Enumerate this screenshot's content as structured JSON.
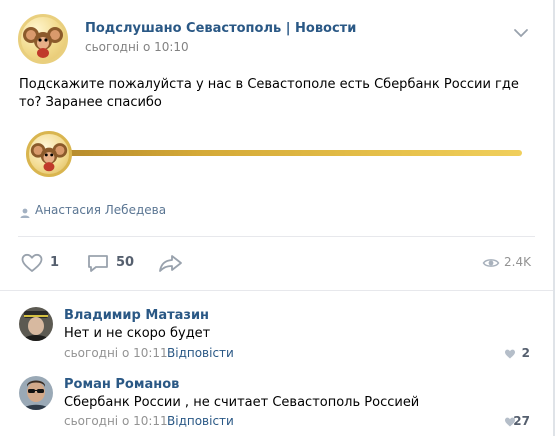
{
  "post": {
    "group_name": "Подслушано Севастополь | Новости",
    "time": "сьогодні о 10:10",
    "text": "Подскажите пожалуйста у нас в Севастополе есть Сбербанк России где то? Заранее спасибо",
    "author": "Анастасия Лебедева",
    "likes": "1",
    "comments": "50",
    "views": "2.4K"
  },
  "icons": {
    "menu": "chevron-down-icon",
    "like": "heart-icon",
    "comment": "speech-bubble-icon",
    "share": "share-arrow-icon",
    "views": "eye-icon",
    "author": "person-icon"
  },
  "comments": [
    {
      "name": "Владимир Матазин",
      "text": "Нет и не скоро будет",
      "time": "сьогодні о 10:11",
      "reply": "Відповісти",
      "likes": "2"
    },
    {
      "name": "Роман Романов",
      "text": "Сбербанк России , не считает Севастополь Россией",
      "time": "сьогодні о 10:11",
      "reply": "Відповісти",
      "likes": "27"
    }
  ],
  "colors": {
    "link": "#2a5885",
    "meta": "#828282",
    "gold": "#e7c24c"
  }
}
